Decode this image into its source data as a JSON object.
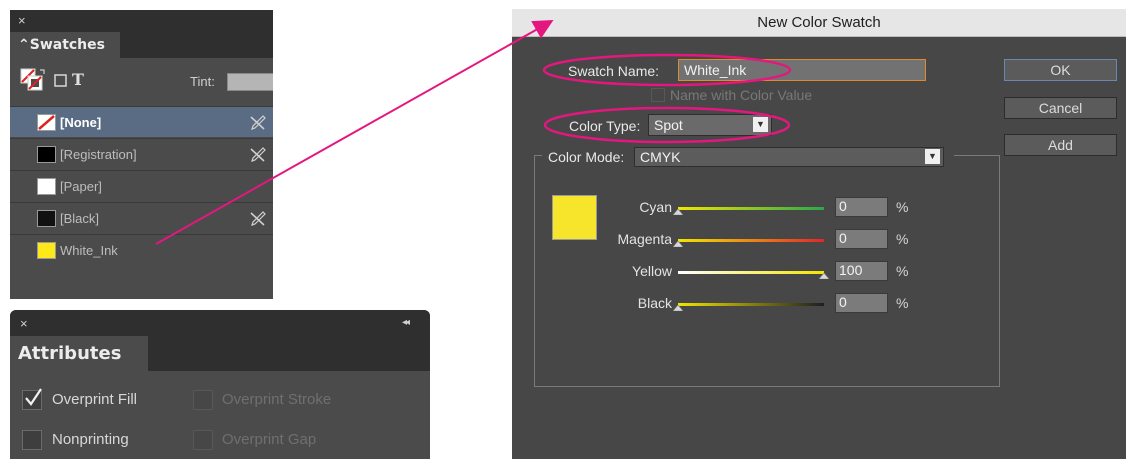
{
  "colors": {
    "swatch_none": "#ffffff",
    "swatch_registration": "#000000",
    "swatch_paper": "#ffffff",
    "swatch_black": "#111111",
    "swatch_white_ink": "#ffe81a",
    "preview_color": "#f7e52b",
    "annotation_magenta": "#e4177f"
  },
  "swatches_panel": {
    "close_glyph": "×",
    "tab_label": "⌃Swatches",
    "tint_label": "Tint:",
    "text_tool_label": "T",
    "items": [
      {
        "name": "[None]",
        "selected": true,
        "spot_icon": true
      },
      {
        "name": "[Registration]",
        "selected": false,
        "spot_icon": true
      },
      {
        "name": "[Paper]",
        "selected": false,
        "spot_icon": false
      },
      {
        "name": "[Black]",
        "selected": false,
        "spot_icon": true
      },
      {
        "name": "White_Ink",
        "selected": false,
        "spot_icon": false
      }
    ]
  },
  "attributes_panel": {
    "close_glyph": "×",
    "collapse_glyph": "◂◂",
    "tab_label": "Attributes",
    "options": [
      {
        "label": "Overprint Fill",
        "checked": true,
        "enabled": true
      },
      {
        "label": "Overprint Stroke",
        "checked": false,
        "enabled": false
      },
      {
        "label": "Nonprinting",
        "checked": false,
        "enabled": true
      },
      {
        "label": "Overprint Gap",
        "checked": false,
        "enabled": false
      }
    ]
  },
  "dialog": {
    "title": "New Color Swatch",
    "swatch_name_label": "Swatch Name:",
    "swatch_name_value": "White_Ink",
    "name_with_color_value_label": "Name with Color Value",
    "color_type_label": "Color Type:",
    "color_type_value": "Spot",
    "color_mode_label": "Color Mode:",
    "color_mode_value": "CMYK",
    "buttons": {
      "ok": "OK",
      "cancel": "Cancel",
      "add": "Add"
    },
    "percent_sign": "%",
    "sliders": [
      {
        "label": "Cyan",
        "value": "0",
        "level": 0,
        "track": [
          "#f2e600",
          "#2ba84a"
        ]
      },
      {
        "label": "Magenta",
        "value": "0",
        "level": 0,
        "track": [
          "#f2e600",
          "#e3262b"
        ]
      },
      {
        "label": "Yellow",
        "value": "100",
        "level": 1,
        "track": [
          "#ffffff",
          "#f2e600"
        ]
      },
      {
        "label": "Black",
        "value": "0",
        "level": 0,
        "track": [
          "#f2e600",
          "#1e1e1e"
        ]
      }
    ]
  }
}
